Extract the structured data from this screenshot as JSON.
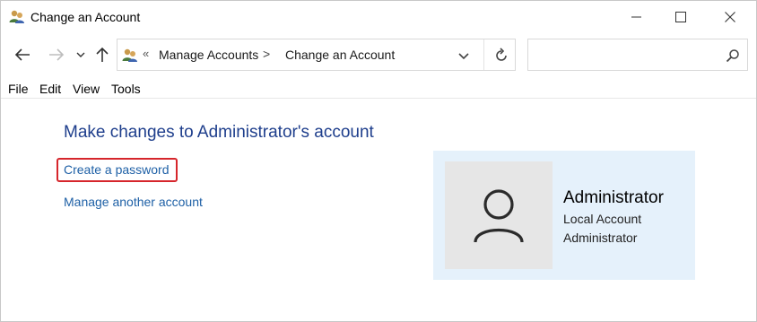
{
  "window": {
    "title": "Change an Account",
    "title_icon": "user-accounts-icon",
    "controls": {
      "minimize": "minimize-icon",
      "maximize": "maximize-icon",
      "close": "close-icon"
    }
  },
  "navigation": {
    "back_icon": "arrow-left-icon",
    "forward_icon": "arrow-right-icon",
    "recent_icon": "chevron-down-icon",
    "up_icon": "arrow-up-icon"
  },
  "address": {
    "overflow_glyph": "«",
    "breadcrumbs": [
      "Manage Accounts",
      "Change an Account"
    ],
    "separator": ">",
    "refresh_icon": "refresh-icon"
  },
  "search": {
    "value": "",
    "placeholder": ""
  },
  "menu": {
    "items": [
      "File",
      "Edit",
      "View",
      "Tools"
    ]
  },
  "content": {
    "heading": "Make changes to Administrator's account",
    "links": {
      "create_password": "Create a password",
      "manage_another": "Manage another account"
    },
    "account": {
      "name": "Administrator",
      "type": "Local Account",
      "role": "Administrator",
      "avatar_icon": "user-icon"
    }
  },
  "colors": {
    "heading": "#1e3e8c",
    "link": "#1e60a6",
    "highlight_border": "#d6262c",
    "card_bg": "#e5f1fb",
    "avatar_bg": "#e6e6e6"
  }
}
